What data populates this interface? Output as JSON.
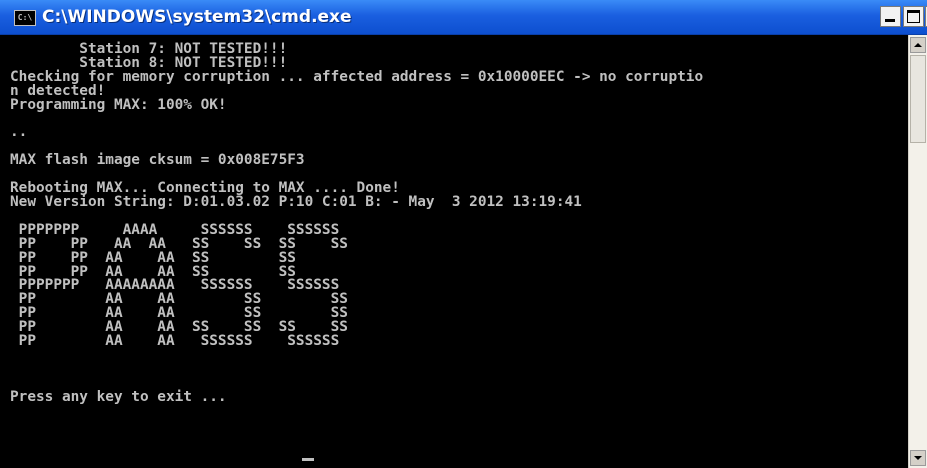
{
  "window": {
    "title": "C:\\WINDOWS\\system32\\cmd.exe",
    "icon_label": "C:\\"
  },
  "console": {
    "lines": [
      "        Station 7: NOT TESTED!!!",
      "        Station 8: NOT TESTED!!!",
      "Checking for memory corruption ... affected address = 0x10000EEC -> no corruptio",
      "n detected!",
      "Programming MAX: 100% OK!",
      "",
      "..",
      "",
      "MAX flash image cksum = 0x008E75F3",
      "",
      "Rebooting MAX... Connecting to MAX .... Done!",
      "New Version String: D:01.03.02 P:10 C:01 B: - May  3 2012 13:19:41",
      "",
      " PPPPPPP     AAAA     SSSSSS    SSSSSS",
      " PP    PP   AA  AA   SS    SS  SS    SS",
      " PP    PP  AA    AA  SS        SS",
      " PP    PP  AA    AA  SS        SS",
      " PPPPPPP   AAAAAAAA   SSSSSS    SSSSSS",
      " PP        AA    AA        SS        SS",
      " PP        AA    AA        SS        SS",
      " PP        AA    AA  SS    SS  SS    SS",
      " PP        AA    AA   SSSSSS    SSSSSS",
      "",
      "",
      "",
      "Press any key to exit ... "
    ]
  },
  "colors": {
    "console_background": "#000000",
    "console_text": "#c0c0c0",
    "titlebar": "#1a5fe0"
  },
  "icons": {
    "app": "cmd-icon",
    "minimize": "minimize-icon",
    "maximize": "maximize-icon",
    "close": "close-icon",
    "scroll_up": "arrow-up-icon",
    "scroll_down": "arrow-down-icon"
  }
}
